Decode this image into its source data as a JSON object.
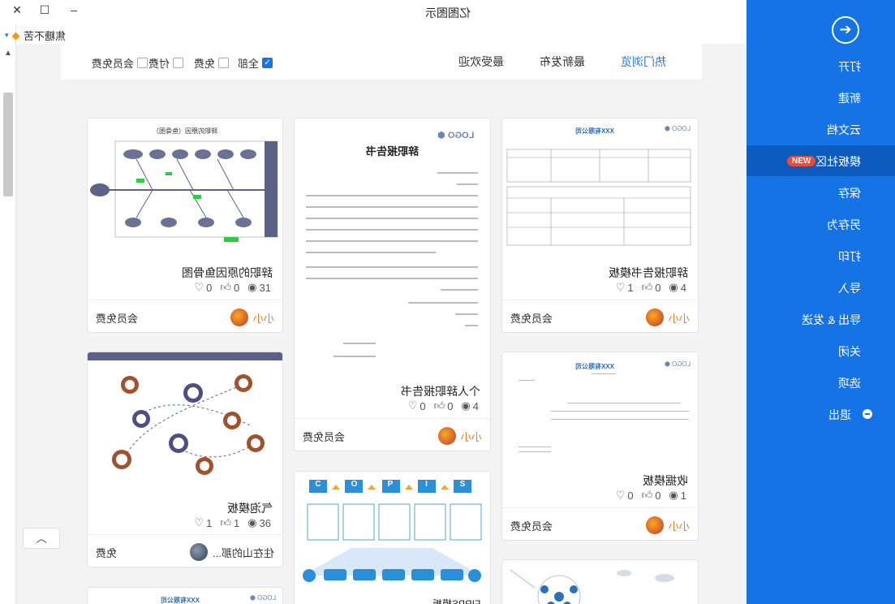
{
  "window": {
    "title": "亿图图示",
    "close": "✕",
    "maximize": "☐",
    "minimize": "–"
  },
  "account": {
    "name": "焦糖不苦",
    "caret": "▾"
  },
  "filter": {
    "tabs": [
      {
        "label": "热门浏览",
        "active": true
      },
      {
        "label": "最新发布",
        "active": false
      },
      {
        "label": "最受欢迎",
        "active": false
      }
    ],
    "checkboxes": [
      {
        "label": "全部",
        "checked": true
      },
      {
        "label": "免费",
        "checked": false
      },
      {
        "label": "付费",
        "checked": false
      },
      {
        "label": "会员免费",
        "checked": false
      }
    ]
  },
  "cards": [
    {
      "title": "辞职报告书模板",
      "views": "4",
      "likes": "0",
      "favorites": "1",
      "price": "会员免费",
      "author": "小小"
    },
    {
      "title": "个人辞职报告书",
      "views": "4",
      "likes": "0",
      "favorites": "0",
      "price": "会员免费",
      "author": "小小"
    },
    {
      "title": "辞职的原因鱼骨图",
      "views": "31",
      "likes": "0",
      "favorites": "0",
      "price": "会员免费",
      "author": "小小"
    },
    {
      "title": "收据模板",
      "views": "1",
      "likes": "0",
      "favorites": "0",
      "price": "会员免费",
      "author": "小小"
    },
    {
      "title": "气泡模板",
      "views": "36",
      "likes": "1",
      "favorites": "1",
      "price": "免费",
      "author": "住在山的那..."
    },
    {
      "title": "FIRPS模板",
      "views": "",
      "likes": "",
      "favorites": "",
      "price": "",
      "author": ""
    }
  ],
  "thumbs": {
    "logo": "LOGO",
    "company": "XXX有限公司",
    "resign_heading": "辞职报告书",
    "fishbone_title": "辞职的原因（鱼骨图）",
    "firps_letters": [
      "S",
      "I",
      "P",
      "O",
      "C"
    ]
  },
  "sidebar": {
    "items": [
      {
        "label": "打开"
      },
      {
        "label": "新建"
      },
      {
        "label": "云文档"
      },
      {
        "label": "模板社区",
        "badge": "NEW",
        "active": true
      },
      {
        "label": "保存"
      },
      {
        "label": "另存为"
      },
      {
        "label": "打印"
      },
      {
        "label": "导入"
      },
      {
        "label": "导出 & 发送"
      },
      {
        "label": "关闭"
      },
      {
        "label": "选项"
      },
      {
        "label": "退出"
      }
    ]
  },
  "scroll": {
    "up": "▲",
    "back_top": "︿"
  },
  "icons": {
    "eye": "eye-icon",
    "like": "thumb-up-icon",
    "heart": "heart-icon",
    "arrow": "arrow-right-circle-icon"
  }
}
